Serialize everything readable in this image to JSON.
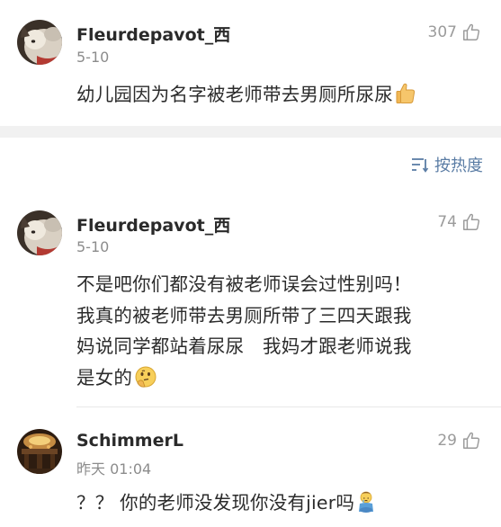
{
  "top_comment": {
    "username": "Fleurdepavot_西",
    "timestamp": "5-10",
    "like_count": "307",
    "text": "幼儿园因为名字被老师带去男厕所尿尿",
    "emoji": "thumbs-up-icon"
  },
  "sort": {
    "label": "按热度",
    "icon": "sort-icon"
  },
  "comments": [
    {
      "username": "Fleurdepavot_西",
      "timestamp": "5-10",
      "like_count": "74",
      "lines": [
        "不是吧你们都没有被老师误会过性别吗！",
        "我真的被老师带去男厕所带了三四天跟我",
        "妈说同学都站着尿尿　我妈才跟老师说我",
        "是女的"
      ],
      "emoji": "thinking-face-icon"
    },
    {
      "username": "SchimmerL",
      "timestamp": "昨天 01:04",
      "like_count": "29",
      "text": "？？ 你的老师没发现你没有jier吗",
      "emoji": "crying-child-icon"
    }
  ],
  "colors": {
    "accent": "#5b7da5",
    "muted": "#8c8c8c",
    "text": "#2b2b2b",
    "band": "#f1f1f1"
  }
}
